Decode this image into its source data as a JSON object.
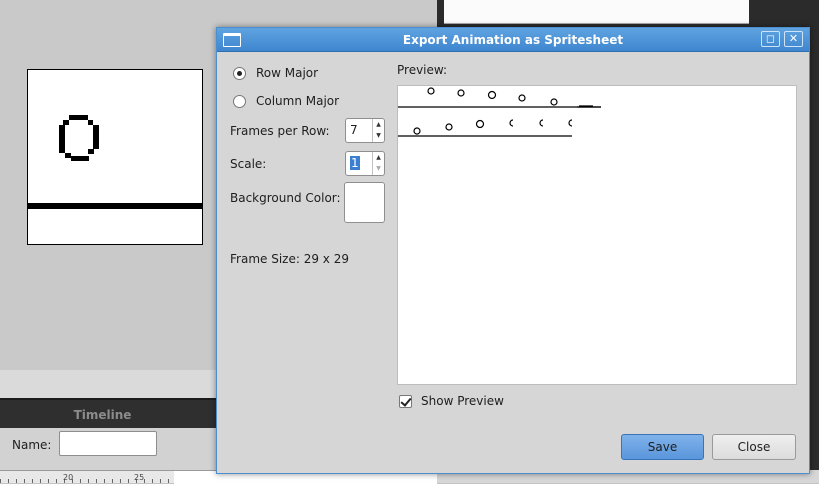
{
  "timeline": {
    "title": "Timeline",
    "name_label": "Name:",
    "name_value": "",
    "ruler_ticks": [
      "20",
      "25"
    ]
  },
  "dialog": {
    "title": "Export Animation as Spritesheet",
    "icons": {
      "window": "window-icon",
      "maximize": "maximize-icon",
      "close": "close-icon"
    },
    "maximize_glyph": "◻",
    "close_glyph": "✕",
    "order": {
      "options": [
        "Row Major",
        "Column Major"
      ],
      "selected": "Row Major"
    },
    "frames_per_row": {
      "label": "Frames per Row:",
      "value": "7"
    },
    "scale": {
      "label": "Scale:",
      "value": "1"
    },
    "background_color": {
      "label": "Background Color:",
      "value": "#ffffff"
    },
    "frame_size": "Frame Size: 29 x 29",
    "preview_label": "Preview:",
    "show_preview": {
      "label": "Show Preview",
      "checked": true
    },
    "buttons": {
      "save": "Save",
      "close": "Close"
    }
  },
  "colors": {
    "accent": "#4a90d0",
    "titlebar": "#4b8fd4",
    "save_button": "#6aa4e4"
  }
}
